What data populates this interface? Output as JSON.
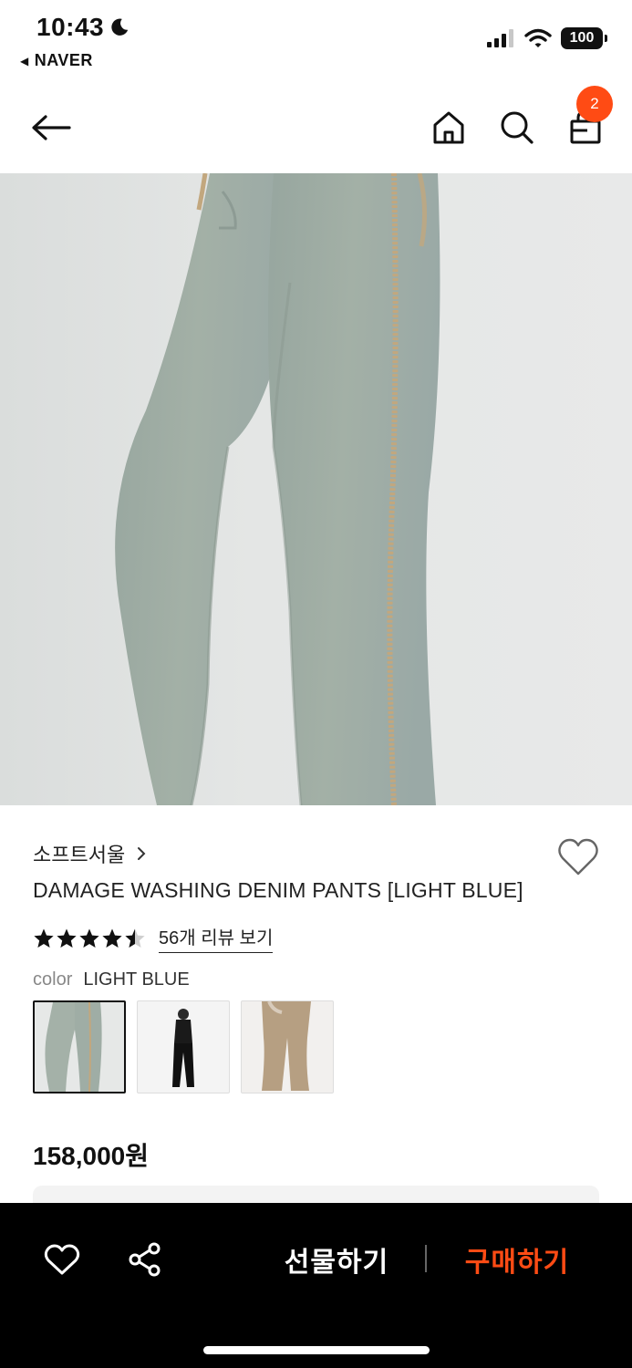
{
  "status_bar": {
    "time": "10:43",
    "back_app": "NAVER",
    "battery": "100"
  },
  "nav": {
    "cart_count": "2"
  },
  "product": {
    "brand": "소프트서울",
    "name": "DAMAGE WASHING DENIM PANTS [LIGHT BLUE]",
    "rating": 4.5,
    "review_link": "56개 리뷰 보기",
    "color_label": "color",
    "color_value": "LIGHT BLUE",
    "price": "158,000원",
    "swatches": [
      {
        "name": "light-blue",
        "color": "#a9b5ad"
      },
      {
        "name": "black",
        "color": "#1c1c1c"
      },
      {
        "name": "beige",
        "color": "#b9a184"
      }
    ]
  },
  "bottom_bar": {
    "gift_label": "선물하기",
    "buy_label": "구매하기"
  },
  "colors": {
    "accent": "#ff4b14",
    "denim": "#9fada5"
  }
}
